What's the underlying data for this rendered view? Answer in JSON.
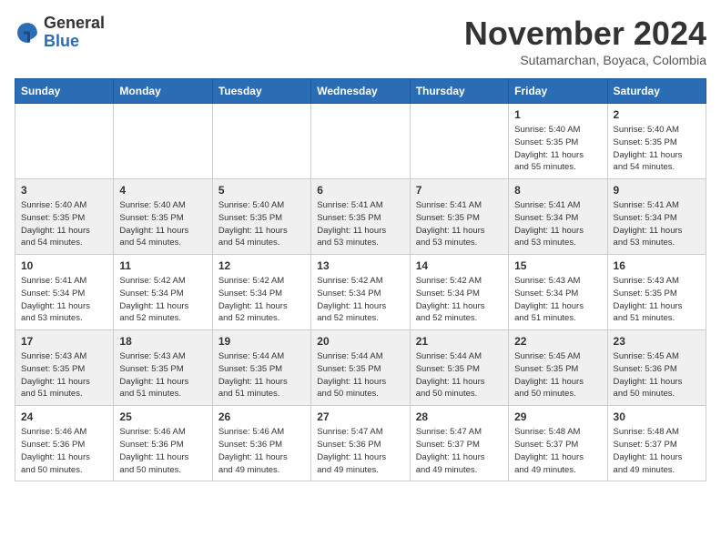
{
  "header": {
    "logo_general": "General",
    "logo_blue": "Blue",
    "month": "November 2024",
    "location": "Sutamarchan, Boyaca, Colombia"
  },
  "weekdays": [
    "Sunday",
    "Monday",
    "Tuesday",
    "Wednesday",
    "Thursday",
    "Friday",
    "Saturday"
  ],
  "weeks": [
    [
      {
        "day": "",
        "info": ""
      },
      {
        "day": "",
        "info": ""
      },
      {
        "day": "",
        "info": ""
      },
      {
        "day": "",
        "info": ""
      },
      {
        "day": "",
        "info": ""
      },
      {
        "day": "1",
        "info": "Sunrise: 5:40 AM\nSunset: 5:35 PM\nDaylight: 11 hours\nand 55 minutes."
      },
      {
        "day": "2",
        "info": "Sunrise: 5:40 AM\nSunset: 5:35 PM\nDaylight: 11 hours\nand 54 minutes."
      }
    ],
    [
      {
        "day": "3",
        "info": "Sunrise: 5:40 AM\nSunset: 5:35 PM\nDaylight: 11 hours\nand 54 minutes."
      },
      {
        "day": "4",
        "info": "Sunrise: 5:40 AM\nSunset: 5:35 PM\nDaylight: 11 hours\nand 54 minutes."
      },
      {
        "day": "5",
        "info": "Sunrise: 5:40 AM\nSunset: 5:35 PM\nDaylight: 11 hours\nand 54 minutes."
      },
      {
        "day": "6",
        "info": "Sunrise: 5:41 AM\nSunset: 5:35 PM\nDaylight: 11 hours\nand 53 minutes."
      },
      {
        "day": "7",
        "info": "Sunrise: 5:41 AM\nSunset: 5:35 PM\nDaylight: 11 hours\nand 53 minutes."
      },
      {
        "day": "8",
        "info": "Sunrise: 5:41 AM\nSunset: 5:34 PM\nDaylight: 11 hours\nand 53 minutes."
      },
      {
        "day": "9",
        "info": "Sunrise: 5:41 AM\nSunset: 5:34 PM\nDaylight: 11 hours\nand 53 minutes."
      }
    ],
    [
      {
        "day": "10",
        "info": "Sunrise: 5:41 AM\nSunset: 5:34 PM\nDaylight: 11 hours\nand 53 minutes."
      },
      {
        "day": "11",
        "info": "Sunrise: 5:42 AM\nSunset: 5:34 PM\nDaylight: 11 hours\nand 52 minutes."
      },
      {
        "day": "12",
        "info": "Sunrise: 5:42 AM\nSunset: 5:34 PM\nDaylight: 11 hours\nand 52 minutes."
      },
      {
        "day": "13",
        "info": "Sunrise: 5:42 AM\nSunset: 5:34 PM\nDaylight: 11 hours\nand 52 minutes."
      },
      {
        "day": "14",
        "info": "Sunrise: 5:42 AM\nSunset: 5:34 PM\nDaylight: 11 hours\nand 52 minutes."
      },
      {
        "day": "15",
        "info": "Sunrise: 5:43 AM\nSunset: 5:34 PM\nDaylight: 11 hours\nand 51 minutes."
      },
      {
        "day": "16",
        "info": "Sunrise: 5:43 AM\nSunset: 5:35 PM\nDaylight: 11 hours\nand 51 minutes."
      }
    ],
    [
      {
        "day": "17",
        "info": "Sunrise: 5:43 AM\nSunset: 5:35 PM\nDaylight: 11 hours\nand 51 minutes."
      },
      {
        "day": "18",
        "info": "Sunrise: 5:43 AM\nSunset: 5:35 PM\nDaylight: 11 hours\nand 51 minutes."
      },
      {
        "day": "19",
        "info": "Sunrise: 5:44 AM\nSunset: 5:35 PM\nDaylight: 11 hours\nand 51 minutes."
      },
      {
        "day": "20",
        "info": "Sunrise: 5:44 AM\nSunset: 5:35 PM\nDaylight: 11 hours\nand 50 minutes."
      },
      {
        "day": "21",
        "info": "Sunrise: 5:44 AM\nSunset: 5:35 PM\nDaylight: 11 hours\nand 50 minutes."
      },
      {
        "day": "22",
        "info": "Sunrise: 5:45 AM\nSunset: 5:35 PM\nDaylight: 11 hours\nand 50 minutes."
      },
      {
        "day": "23",
        "info": "Sunrise: 5:45 AM\nSunset: 5:36 PM\nDaylight: 11 hours\nand 50 minutes."
      }
    ],
    [
      {
        "day": "24",
        "info": "Sunrise: 5:46 AM\nSunset: 5:36 PM\nDaylight: 11 hours\nand 50 minutes."
      },
      {
        "day": "25",
        "info": "Sunrise: 5:46 AM\nSunset: 5:36 PM\nDaylight: 11 hours\nand 50 minutes."
      },
      {
        "day": "26",
        "info": "Sunrise: 5:46 AM\nSunset: 5:36 PM\nDaylight: 11 hours\nand 49 minutes."
      },
      {
        "day": "27",
        "info": "Sunrise: 5:47 AM\nSunset: 5:36 PM\nDaylight: 11 hours\nand 49 minutes."
      },
      {
        "day": "28",
        "info": "Sunrise: 5:47 AM\nSunset: 5:37 PM\nDaylight: 11 hours\nand 49 minutes."
      },
      {
        "day": "29",
        "info": "Sunrise: 5:48 AM\nSunset: 5:37 PM\nDaylight: 11 hours\nand 49 minutes."
      },
      {
        "day": "30",
        "info": "Sunrise: 5:48 AM\nSunset: 5:37 PM\nDaylight: 11 hours\nand 49 minutes."
      }
    ]
  ]
}
